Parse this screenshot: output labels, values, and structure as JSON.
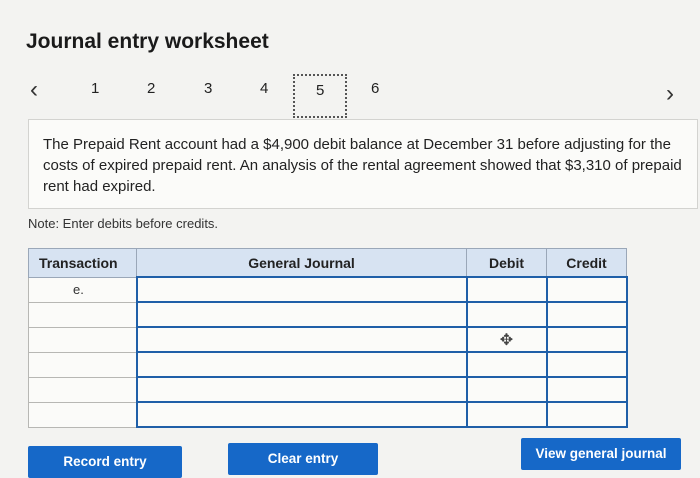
{
  "header": {
    "title": "Journal entry worksheet"
  },
  "pager": {
    "prev_icon": "‹",
    "next_icon": "›",
    "pages": [
      "1",
      "2",
      "3",
      "4",
      "5",
      "6"
    ],
    "active_page": "5"
  },
  "prompt": {
    "text": "The Prepaid Rent account had a $4,900 debit balance at December 31 before adjusting for the costs of expired prepaid rent. An analysis of the rental agreement showed that $3,310 of prepaid rent had expired."
  },
  "note": "Note: Enter debits before credits.",
  "journal": {
    "headers": {
      "transaction": "Transaction",
      "general_journal": "General Journal",
      "debit": "Debit",
      "credit": "Credit"
    },
    "rows": [
      {
        "transaction": "e.",
        "account": "",
        "debit": "",
        "credit": ""
      },
      {
        "transaction": "",
        "account": "",
        "debit": "",
        "credit": ""
      },
      {
        "transaction": "",
        "account": "",
        "debit": "",
        "credit": ""
      },
      {
        "transaction": "",
        "account": "",
        "debit": "",
        "credit": ""
      },
      {
        "transaction": "",
        "account": "",
        "debit": "",
        "credit": ""
      },
      {
        "transaction": "",
        "account": "",
        "debit": "",
        "credit": ""
      }
    ]
  },
  "buttons": {
    "record_entry": "Record entry",
    "clear_entry": "Clear entry",
    "view_general_journal": "View general journal"
  },
  "colors": {
    "accent": "#1668c8",
    "header_bg": "#d7e3f2",
    "input_border": "#1f5fa8"
  }
}
